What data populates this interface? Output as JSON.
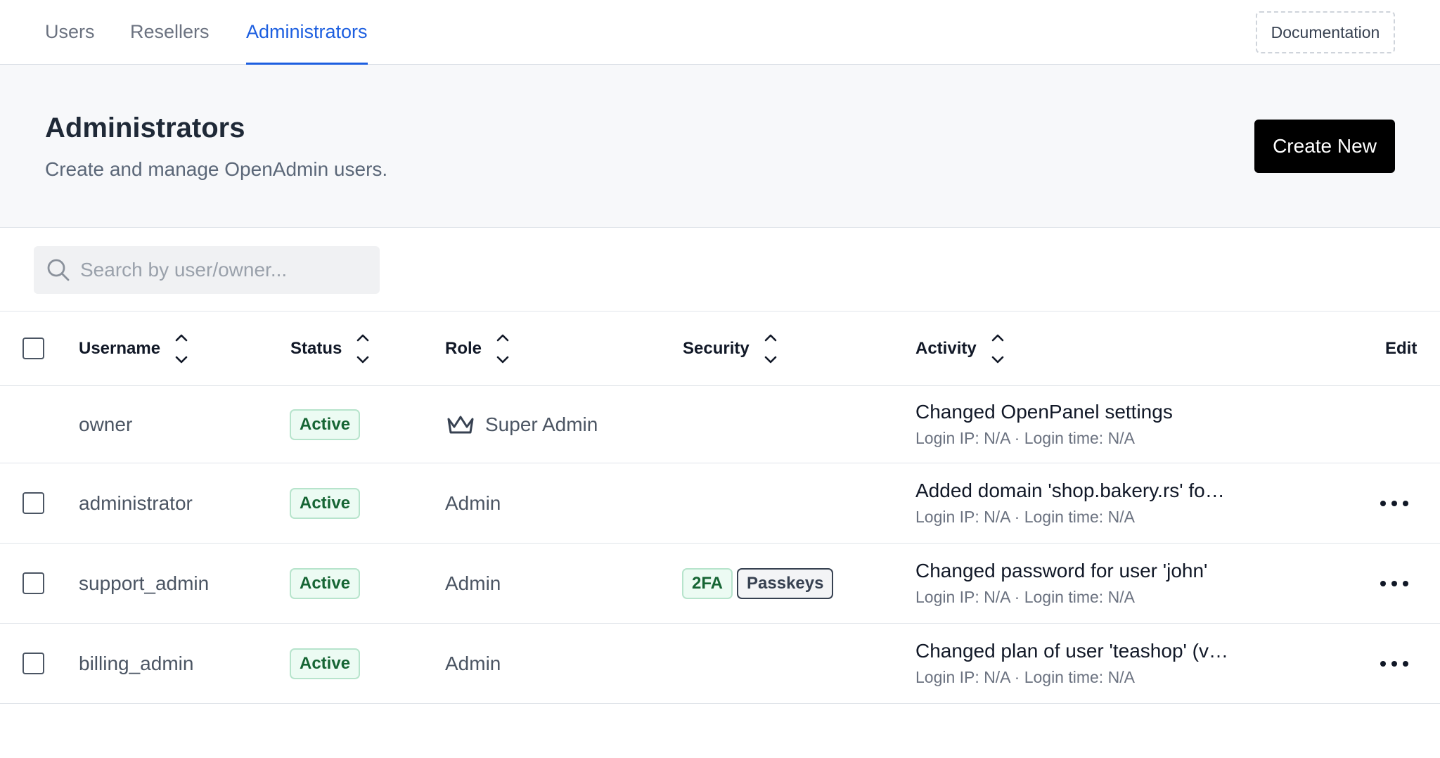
{
  "tabs": [
    {
      "label": "Users",
      "active": false
    },
    {
      "label": "Resellers",
      "active": false
    },
    {
      "label": "Administrators",
      "active": true
    }
  ],
  "documentation_label": "Documentation",
  "header": {
    "title": "Administrators",
    "subtitle": "Create and manage OpenAdmin users.",
    "create_label": "Create New"
  },
  "search": {
    "placeholder": "Search by user/owner...",
    "value": ""
  },
  "table": {
    "columns": {
      "username": "Username",
      "status": "Status",
      "role": "Role",
      "security": "Security",
      "activity": "Activity",
      "edit": "Edit"
    },
    "rows": [
      {
        "username": "owner",
        "status": "Active",
        "role": "Super Admin",
        "role_icon": "crown-icon",
        "security": [],
        "activity": "Changed OpenPanel settings",
        "activity_meta": "Login IP: N/A · Login time: N/A",
        "selectable": false,
        "editable": false
      },
      {
        "username": "administrator",
        "status": "Active",
        "role": "Admin",
        "security": [],
        "activity": "Added domain 'shop.bakery.rs' fo…",
        "activity_meta": "Login IP: N/A · Login time: N/A",
        "selectable": true,
        "editable": true
      },
      {
        "username": "support_admin",
        "status": "Active",
        "role": "Admin",
        "security": [
          "2FA",
          "Passkeys"
        ],
        "activity": "Changed password for user 'john'",
        "activity_meta": "Login IP: N/A · Login time: N/A",
        "selectable": true,
        "editable": true
      },
      {
        "username": "billing_admin",
        "status": "Active",
        "role": "Admin",
        "security": [],
        "activity": "Changed plan of user 'teashop' (v…",
        "activity_meta": "Login IP: N/A · Login time: N/A",
        "selectable": true,
        "editable": true
      }
    ]
  },
  "colors": {
    "accent": "#1d5fe0",
    "primary_button": "#000000",
    "status_active_bg": "#ecfbf3",
    "status_active_text": "#166534"
  }
}
